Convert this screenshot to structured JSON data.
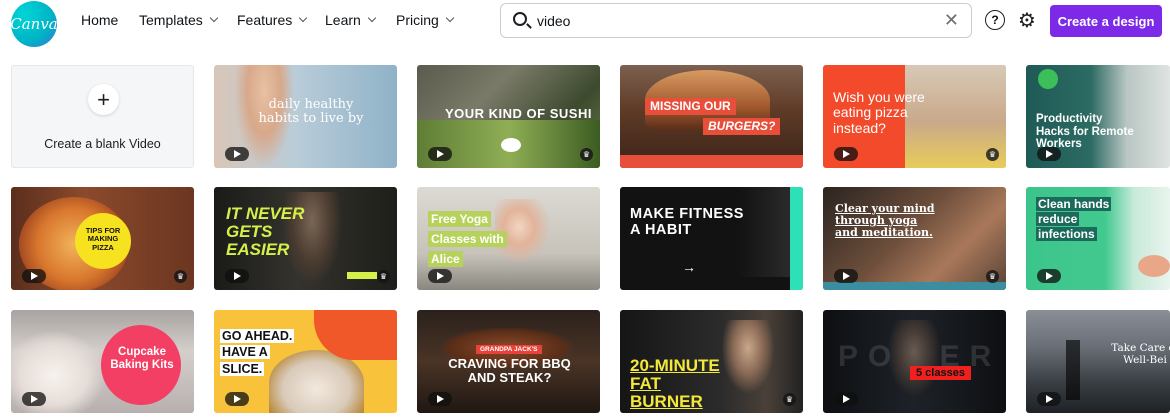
{
  "header": {
    "logo_text": "Canva",
    "nav": [
      "Home",
      "Templates",
      "Features",
      "Learn",
      "Pricing"
    ],
    "search_value": "video",
    "create_label": "Create a design"
  },
  "blank_card": {
    "label": "Create a blank Video"
  },
  "templates": {
    "t1": "daily healthy habits to live by",
    "t2": "YOUR KIND OF SUSHI",
    "t3a": "MISSING OUR",
    "t3b": "BURGERS?",
    "t4": "Wish you were eating pizza instead?",
    "t5": "Productivity Hacks for Remote Workers",
    "t6": "TIPS FOR MAKING PIZZA",
    "t7": "IT NEVER GETS EASIER",
    "t8": "Free Yoga Classes with Alice",
    "t9": "MAKE FITNESS A HABIT",
    "t10": "Clear your mind through yoga and meditation.",
    "t11": "Clean hands reduce infections",
    "t12": "Cupcake Baking Kits",
    "t13": "GO AHEAD. HAVE A SLICE.",
    "t14a": "GRANDPA JACK'S",
    "t14b": "CRAVING FOR BBQ AND STEAK?",
    "t15": "20-MINUTE FAT BURNER",
    "t16a": "POWER",
    "t16b": "5 classes",
    "t17": "Take Care of Well-Bei"
  },
  "icons": [
    "search-icon",
    "clear-icon",
    "help-icon",
    "gear-icon",
    "plus-icon",
    "play-icon",
    "pro-crown-icon"
  ]
}
